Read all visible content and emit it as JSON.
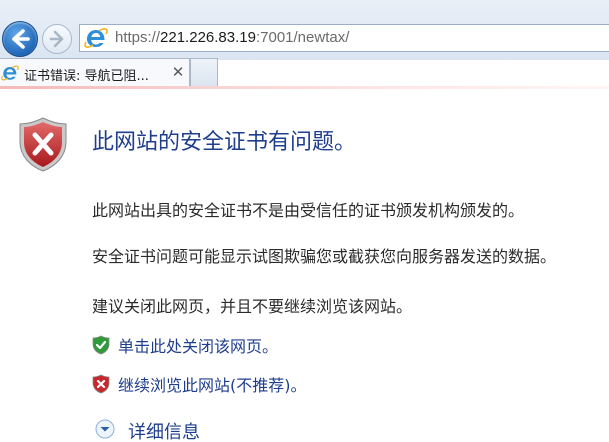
{
  "browser": {
    "address_bar": {
      "url_scheme": "https://",
      "url_host": "221.226.83.19",
      "url_rest": ":7001/newtax/"
    },
    "tab": {
      "title": "证书错误: 导航已阻...",
      "close_glyph": "✕"
    }
  },
  "page": {
    "headline": "此网站的安全证书有问题。",
    "paragraphs": [
      "此网站出具的安全证书不是由受信任的证书颁发机构颁发的。",
      "安全证书问题可能显示试图欺骗您或截获您向服务器发送的数据。",
      "建议关闭此网页，并且不要继续浏览该网站。"
    ],
    "actions": [
      {
        "label": "单击此处关闭该网页。",
        "icon": "green-shield-check-icon"
      },
      {
        "label": "继续浏览此网站(不推荐)。",
        "icon": "red-shield-x-icon"
      }
    ],
    "details_label": "详细信息"
  },
  "colors": {
    "headline": "#1f3e8e",
    "link": "#1f3e8e",
    "body_text": "#2b2b2b",
    "error_red": "#c8282c",
    "ok_green": "#2f9a3a"
  }
}
